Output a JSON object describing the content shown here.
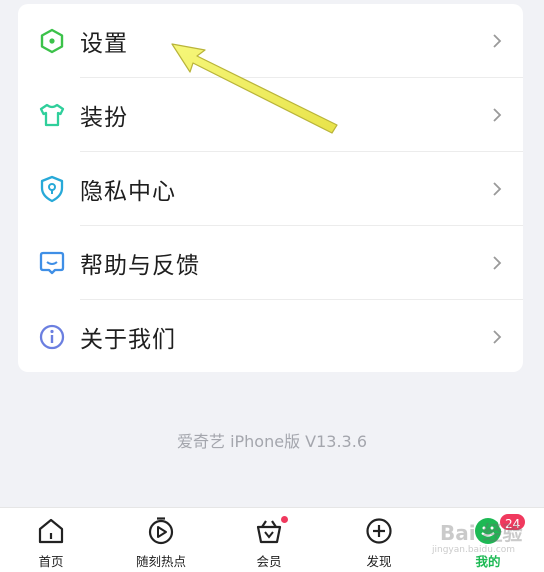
{
  "menu": {
    "items": [
      {
        "label": "设置",
        "icon": "hexagon-settings-icon"
      },
      {
        "label": "装扮",
        "icon": "tshirt-icon"
      },
      {
        "label": "隐私中心",
        "icon": "shield-lock-icon"
      },
      {
        "label": "帮助与反馈",
        "icon": "chat-feedback-icon"
      },
      {
        "label": "关于我们",
        "icon": "info-icon"
      }
    ]
  },
  "version": "爱奇艺 iPhone版 V13.3.6",
  "tabbar": {
    "tabs": [
      {
        "label": "首页",
        "icon": "home-icon"
      },
      {
        "label": "随刻热点",
        "icon": "play-clock-icon"
      },
      {
        "label": "会员",
        "icon": "vip-basket-icon"
      },
      {
        "label": "发现",
        "icon": "discover-plus-icon"
      },
      {
        "label": "我的",
        "icon": "profile-icon"
      }
    ],
    "my_badge": "24"
  },
  "watermark": {
    "text": "Bai 经验",
    "url": "jingyan.baidu.com"
  },
  "colors": {
    "accent": "#1db954",
    "badge": "#f0395e",
    "background": "#f1f2f6"
  }
}
